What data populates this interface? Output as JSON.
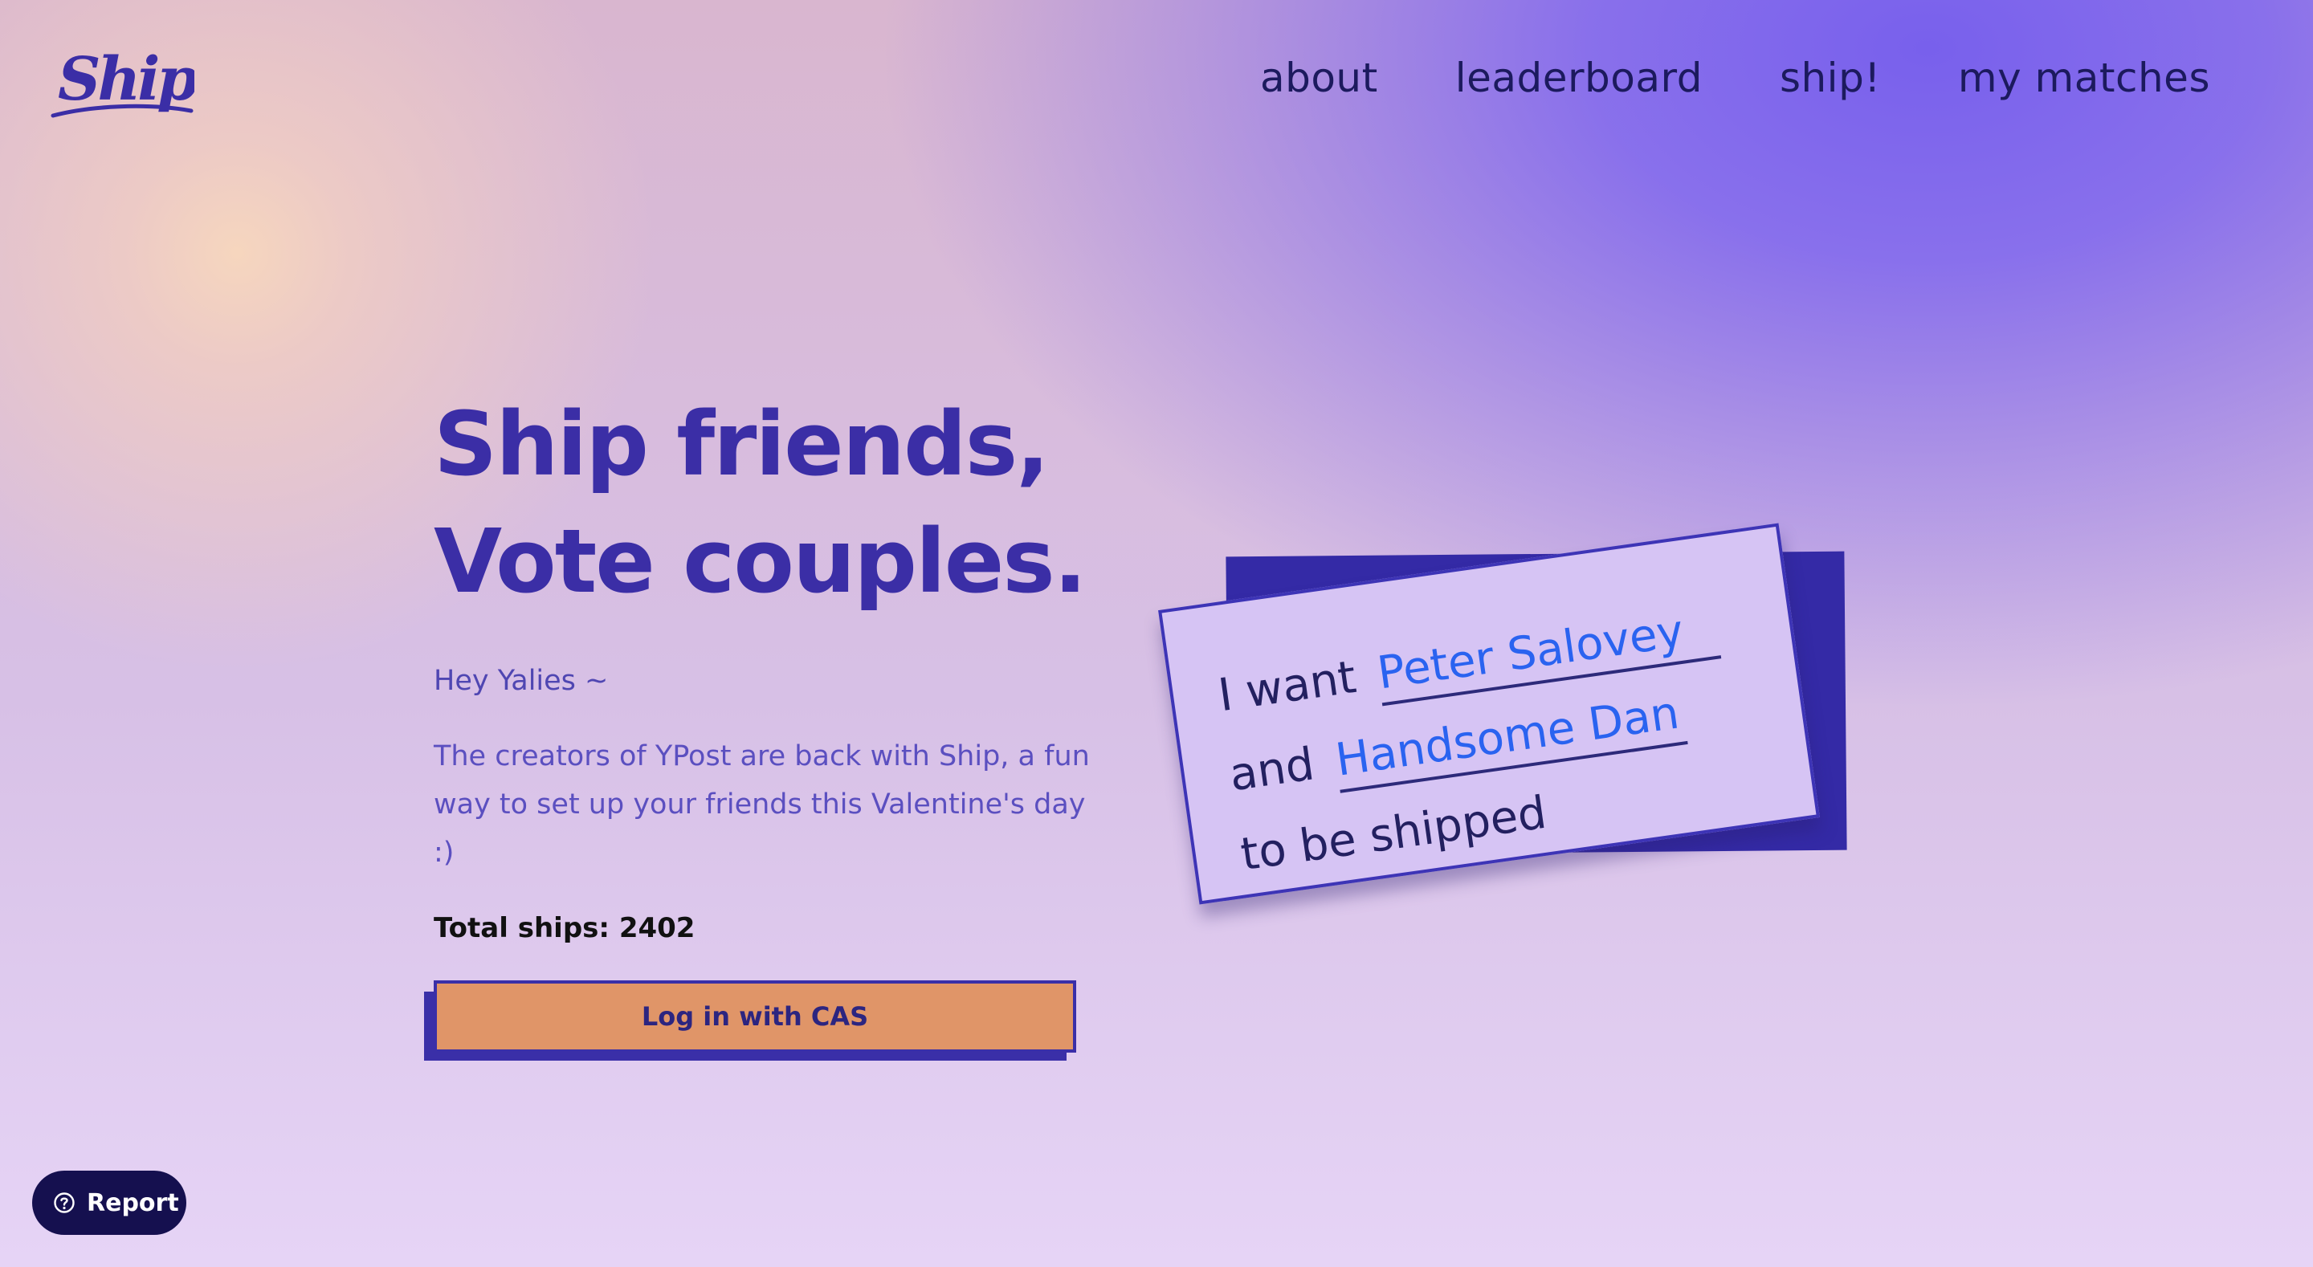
{
  "brand": {
    "logo_text": "Ship",
    "color": "#3b2ea6"
  },
  "nav": {
    "items": [
      {
        "label": "about"
      },
      {
        "label": "leaderboard"
      },
      {
        "label": "ship!"
      },
      {
        "label": "my matches"
      }
    ]
  },
  "hero": {
    "headline_line1": "Ship friends,",
    "headline_line2": "Vote couples.",
    "greeting": "Hey Yalies ~",
    "description": "The creators of YPost are back with Ship, a fun way to set up your friends this Valentine's day :)",
    "total_label": "Total ships: 2402",
    "login_label": "Log in with CAS"
  },
  "card": {
    "line1_prefix": "I want",
    "name1": "Peter Salovey",
    "line2_prefix": "and",
    "name2": "Handsome Dan",
    "line3": "to be shipped"
  },
  "report": {
    "label": "Report",
    "icon": "question-circle-icon"
  },
  "colors": {
    "primary": "#3b2ea6",
    "button": "#e09568",
    "name_blue": "#2a63f0",
    "report_bg": "#15104f"
  }
}
